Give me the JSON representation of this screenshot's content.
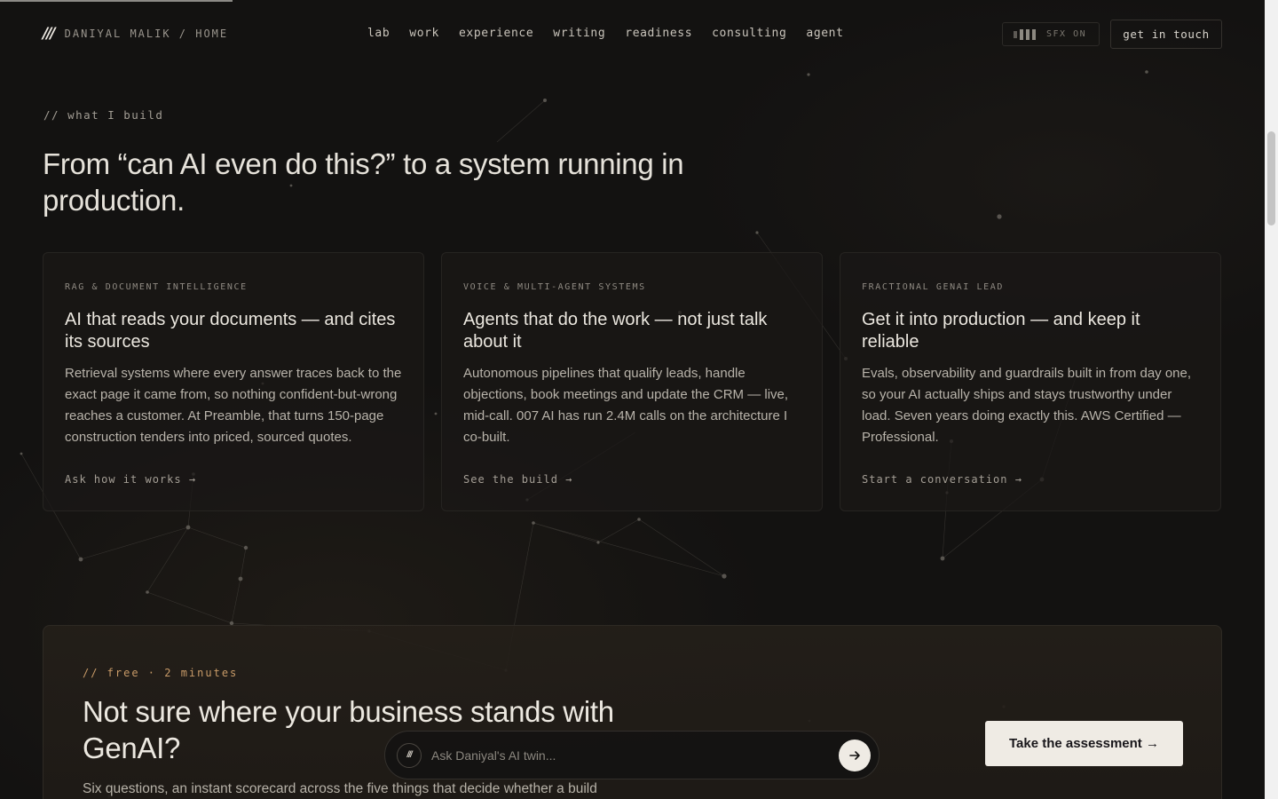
{
  "header": {
    "logo_mark": "///",
    "logo_text": "DANIYAL MALIK / HOME",
    "nav": [
      "lab",
      "work",
      "experience",
      "writing",
      "readiness",
      "consulting",
      "agent"
    ],
    "sfx_label": "SFX ON",
    "cta_label": "get in touch"
  },
  "section": {
    "eyebrow": "// what I build",
    "headline": "From “can AI even do this?” to a system running in production.",
    "cards": [
      {
        "tag": "RAG & DOCUMENT INTELLIGENCE",
        "title": "AI that reads your documents — and cites its sources",
        "body": "Retrieval systems where every answer traces back to the exact page it came from, so nothing confident-but-wrong reaches a customer. At Preamble, that turns 150-page construction tenders into priced, sourced quotes.",
        "link": "Ask how it works →"
      },
      {
        "tag": "VOICE & MULTI-AGENT SYSTEMS",
        "title": "Agents that do the work — not just talk about it",
        "body": "Autonomous pipelines that qualify leads, handle objections, book meetings and update the CRM — live, mid-call. 007 AI has run 2.4M calls on the architecture I co-built.",
        "link": "See the build →"
      },
      {
        "tag": "FRACTIONAL GENAI LEAD",
        "title": "Get it into production — and keep it reliable",
        "body": "Evals, observability and guardrails built in from day one, so your AI actually ships and stays trustworthy under load. Seven years doing exactly this. AWS Certified — Professional.",
        "link": "Start a conversation →"
      }
    ]
  },
  "assessment": {
    "eyebrow": "// free · 2 minutes",
    "title": "Not sure where your business stands with GenAI?",
    "body": "Six questions, an instant scorecard across the five things that decide whether a build",
    "button": "Take the assessment →"
  },
  "chat": {
    "avatar": "///",
    "placeholder": "Ask Daniyal's AI twin...",
    "send_icon": "arrow-right-icon"
  }
}
